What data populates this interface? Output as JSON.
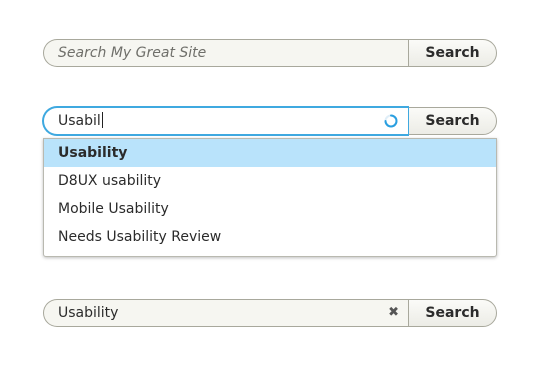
{
  "search1": {
    "placeholder": "Search My Great Site",
    "button_label": "Search"
  },
  "search2": {
    "value": "Usabil",
    "button_label": "Search",
    "loading_icon": "spinner-icon",
    "suggestions": [
      "Usability",
      "D8UX usability",
      "Mobile Usability",
      "Needs Usability Review"
    ]
  },
  "search3": {
    "value": "Usability",
    "clear_icon": "close-icon",
    "button_label": "Search"
  },
  "colors": {
    "focus_border": "#3fa9e0",
    "highlight": "#b9e3fb"
  }
}
